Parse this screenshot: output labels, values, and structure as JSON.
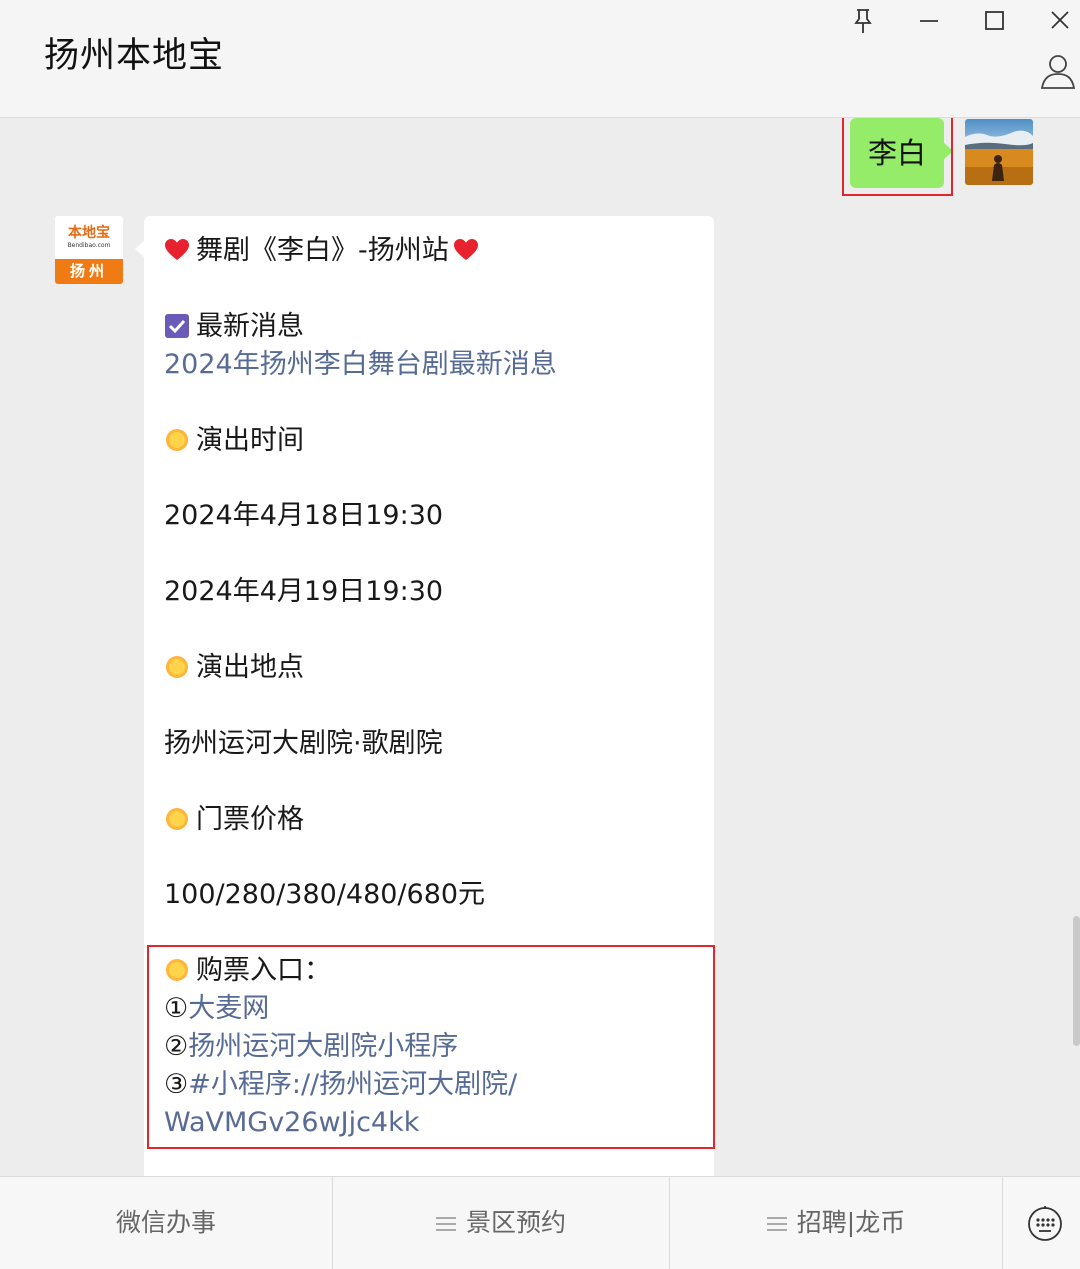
{
  "window": {
    "title": "扬州本地宝",
    "controls": [
      "pin-icon",
      "minimize-icon",
      "maximize-icon",
      "close-icon"
    ],
    "profile_icon": "person-icon"
  },
  "brand_avatar": {
    "logo_text": "本地宝",
    "logo_sub": "Bendibao.com",
    "city": "扬州"
  },
  "outgoing_message": {
    "text": "李白",
    "bubble_color": "#95ec69"
  },
  "incoming_message": {
    "title": "舞剧《李白》-扬州站",
    "latest_heading": "最新消息",
    "latest_link": "2024年扬州李白舞台剧最新消息",
    "time_heading": "演出时间",
    "time_1": "2024年4月18日19:30",
    "time_2": "2024年4月19日19:30",
    "venue_heading": "演出地点",
    "venue": "扬州运河大剧院·歌剧院",
    "price_heading": "门票价格",
    "price": "100/280/380/480/680元",
    "purchase_heading": "购票入口：",
    "purchase_options": [
      {
        "num": "①",
        "text": "大麦网"
      },
      {
        "num": "②",
        "text": "扬州运河大剧院小程序"
      },
      {
        "num": "③",
        "text": "#小程序://扬州运河大剧院/"
      }
    ],
    "purchase_code": "WaVMGv26wJjc4kk",
    "link_color": "#576b95",
    "highlight_color": "#e3262d"
  },
  "bottom_menu": {
    "items": [
      "微信办事",
      "景区预约",
      "招聘|龙币"
    ],
    "keyboard_icon": "keyboard-icon"
  }
}
